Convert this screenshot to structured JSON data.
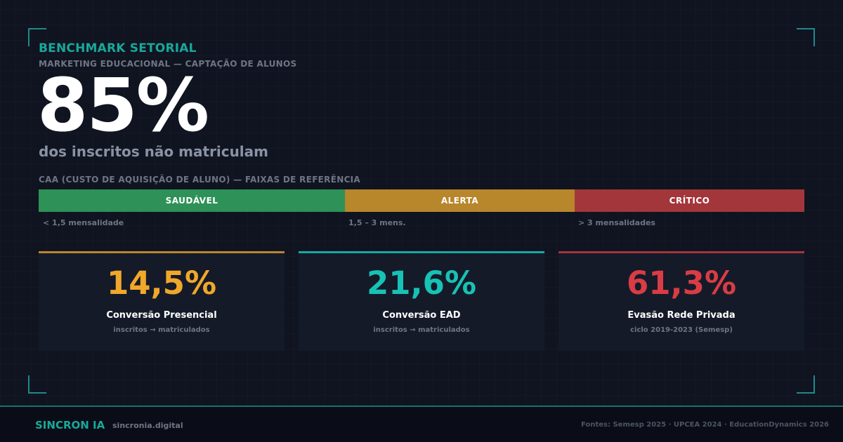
{
  "header": {
    "title": "BENCHMARK SETORIAL",
    "subtitle": "MARKETING EDUCACIONAL — CAPTAÇÃO DE ALUNOS"
  },
  "hero": {
    "value": "85%",
    "caption": "dos inscritos não matriculam"
  },
  "scale": {
    "title": "CAA (CUSTO DE AQUISIÇÃO DE ALUNO) — FAIXAS DE REFERÊNCIA",
    "segments": [
      {
        "label": "SAUDÁVEL",
        "range": "< 1,5 mensalidade",
        "color": "#2e9158"
      },
      {
        "label": "ALERTA",
        "range": "1,5 – 3 mens.",
        "color": "#b8862b"
      },
      {
        "label": "CRÍTICO",
        "range": "> 3 mensalidades",
        "color": "#a3363b"
      }
    ]
  },
  "cards": [
    {
      "value": "14,5%",
      "label": "Conversão Presencial",
      "sub": "inscritos → matriculados",
      "color": "#f0a82a"
    },
    {
      "value": "21,6%",
      "label": "Conversão EAD",
      "sub": "inscritos → matriculados",
      "color": "#17c2b4"
    },
    {
      "value": "61,3%",
      "label": "Evasão Rede Privada",
      "sub": "ciclo 2019-2023 (Semesp)",
      "color": "#d93c44"
    }
  ],
  "footer": {
    "brand": "SINCRON IA",
    "site": "sincronia.digital",
    "sources": "Fontes: Semesp 2025 · UPCEA 2024 · EducationDynamics 2026"
  },
  "colors": {
    "accent": "#19a89b",
    "background": "#0f1420"
  }
}
